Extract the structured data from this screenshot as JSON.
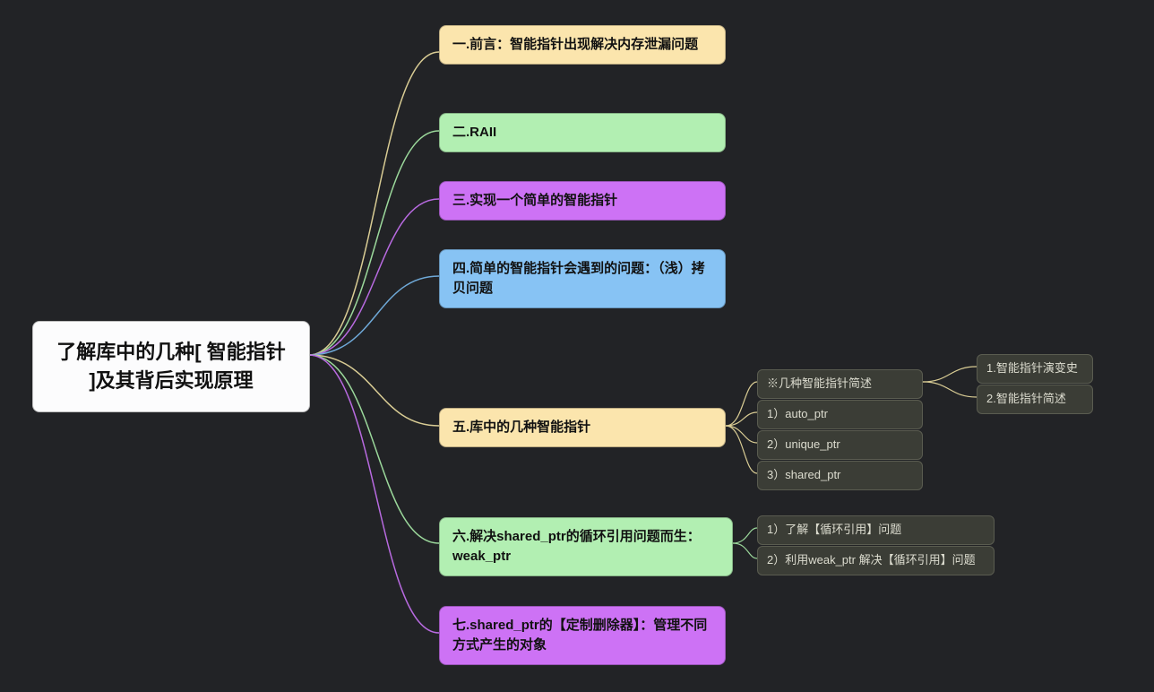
{
  "root": {
    "label": "了解库中的几种[ 智能指针 ]及其背后实现原理"
  },
  "level1": [
    {
      "id": "n1",
      "label": "一.前言：智能指针出现解决内存泄漏问题",
      "color": "cream"
    },
    {
      "id": "n2",
      "label": "二.RAII",
      "color": "green"
    },
    {
      "id": "n3",
      "label": "三.实现一个简单的智能指针",
      "color": "purple"
    },
    {
      "id": "n4",
      "label": "四.简单的智能指针会遇到的问题：（浅）拷贝问题",
      "color": "blue"
    },
    {
      "id": "n5",
      "label": "五.库中的几种智能指针",
      "color": "cream"
    },
    {
      "id": "n6",
      "label": "六.解决shared_ptr的循环引用问题而生：weak_ptr",
      "color": "green"
    },
    {
      "id": "n7",
      "label": "七.shared_ptr的【定制删除器】：管理不同方式产生的对象",
      "color": "purple"
    }
  ],
  "n5_children": [
    {
      "id": "n5a",
      "label": "※几种智能指针简述"
    },
    {
      "id": "n5b",
      "label": "1）auto_ptr"
    },
    {
      "id": "n5c",
      "label": "2）unique_ptr"
    },
    {
      "id": "n5d",
      "label": "3）shared_ptr"
    }
  ],
  "n5a_children": [
    {
      "id": "n5a1",
      "label": "1.智能指针演变史"
    },
    {
      "id": "n5a2",
      "label": "2.智能指针简述"
    }
  ],
  "n6_children": [
    {
      "id": "n6a",
      "label": "1）了解【循环引用】问题"
    },
    {
      "id": "n6b",
      "label": "2）利用weak_ptr 解决【循环引用】问题"
    }
  ]
}
